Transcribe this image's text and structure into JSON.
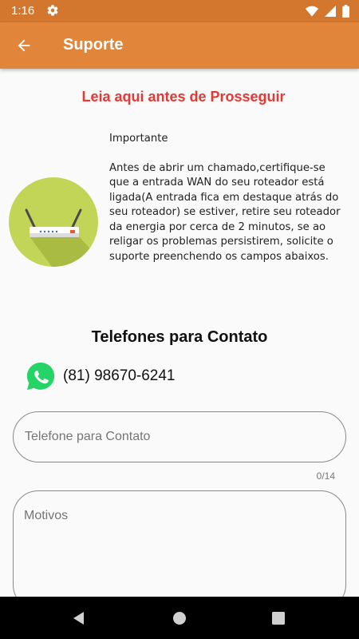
{
  "status_bar": {
    "time": "1:16",
    "icons": [
      "gear-icon",
      "wifi-icon",
      "cell-signal-icon",
      "battery-icon"
    ]
  },
  "app_bar": {
    "title": "Suporte",
    "back_icon": "arrow-left-icon"
  },
  "warning_title": "Leia aqui antes de Prosseguir",
  "info": {
    "image_icon": "router-icon",
    "heading": "Importante",
    "body": "Antes de abrir um chamado,certifique-se que a entrada WAN do seu roteador está ligada(A entrada fica em destaque atrás do seu roteador) se estiver, retire seu roteador da energia por cerca de 2 minutos, se ao religar os problemas persistirem, solicite o suporte preenchendo os campos abaixos."
  },
  "contact": {
    "heading": "Telefones para Contato",
    "whatsapp_icon": "whatsapp-icon",
    "phone": "(81) 98670-6241"
  },
  "form": {
    "phone_placeholder": "Telefone para Contato",
    "phone_value": "",
    "counter": "0/14",
    "reasons_placeholder": "Motivos",
    "reasons_value": ""
  },
  "nav_bar": {
    "icons": [
      "back-triangle-icon",
      "home-circle-icon",
      "recents-square-icon"
    ]
  },
  "colors": {
    "status_bar": "#d3772e",
    "app_bar": "#e0853a",
    "warning": "#e53935",
    "whatsapp": "#25d366",
    "router_circle": "#c3d556"
  }
}
